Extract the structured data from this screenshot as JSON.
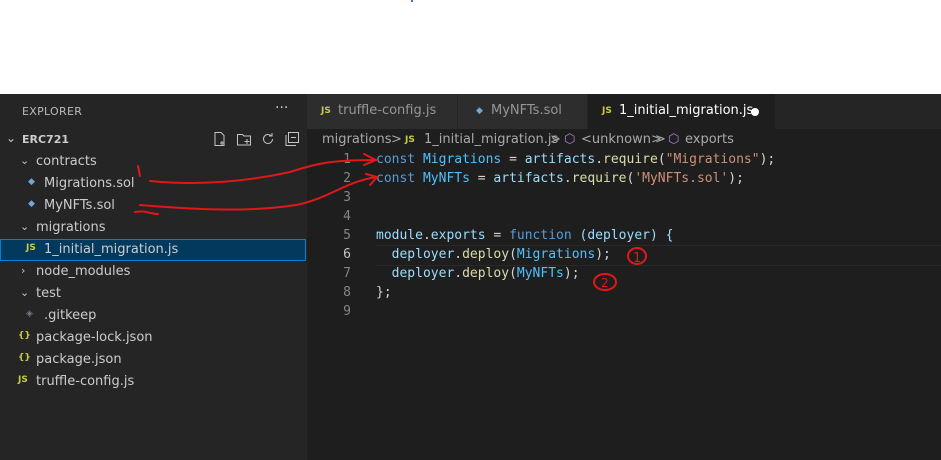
{
  "explorer": {
    "title": "EXPLORER",
    "more": "···",
    "section_title": "ERC721",
    "tree": [
      {
        "label": "contracts",
        "type": "folder",
        "expanded": true
      },
      {
        "label": "Migrations.sol",
        "type": "sol"
      },
      {
        "label": "MyNFTs.sol",
        "type": "sol"
      },
      {
        "label": "migrations",
        "type": "folder",
        "expanded": true
      },
      {
        "label": "1_initial_migration.js",
        "type": "js",
        "selected": true
      },
      {
        "label": "node_modules",
        "type": "folder",
        "expanded": false
      },
      {
        "label": "test",
        "type": "folder",
        "expanded": true
      },
      {
        "label": ".gitkeep",
        "type": "git"
      },
      {
        "label": "package-lock.json",
        "type": "json"
      },
      {
        "label": "package.json",
        "type": "json"
      },
      {
        "label": "truffle-config.js",
        "type": "js"
      }
    ]
  },
  "tabs": [
    {
      "label": "truffle-config.js",
      "icon": "JS",
      "active": false
    },
    {
      "label": "MyNFTs.sol",
      "icon": "sol",
      "active": false
    },
    {
      "label": "1_initial_migration.js",
      "icon": "JS",
      "active": true,
      "dirty": true
    }
  ],
  "breadcrumb": {
    "folder": "migrations",
    "file": "1_initial_migration.js",
    "symbol1": "<unknown>",
    "symbol2": "exports",
    "sep": ">"
  },
  "editor": {
    "line_numbers": [
      "1",
      "2",
      "3",
      "4",
      "5",
      "6",
      "7",
      "8",
      "9"
    ],
    "active_line": 6,
    "l1": {
      "kw": "const",
      "var": "Migrations",
      "eq": " = ",
      "obj": "artifacts",
      "dot": ".",
      "fn": "require",
      "open": "(",
      "str": "\"Migrations\"",
      "close": ");"
    },
    "l2": {
      "kw": "const",
      "var": "MyNFTs",
      "eq": " = ",
      "obj": "artifacts",
      "dot": ".",
      "fn": "require",
      "open": "(",
      "str": "'MyNFTs.sol'",
      "close": ");"
    },
    "l5": {
      "mod": "module",
      "dot": ".",
      "exports": "exports",
      "eq": " = ",
      "kw": "function",
      "params": " (deployer) {"
    },
    "l6": {
      "obj": "deployer",
      "dot": ".",
      "fn": "deploy",
      "open": "(",
      "arg": "Migrations",
      "close": ");"
    },
    "l7": {
      "obj": "deployer",
      "dot": ".",
      "fn": "deploy",
      "open": "(",
      "arg": "MyNFTs",
      "close": ");"
    },
    "l8": {
      "text": "};"
    }
  },
  "annotations": {
    "color": "#e01818",
    "num1": "1",
    "num2": "2",
    "circled1": "1",
    "circled2": "2"
  },
  "colors": {
    "sidebar_bg": "#252526",
    "editor_bg": "#1e1e1e",
    "selection": "#04395e",
    "keyword": "#569cd6",
    "string": "#ce9178",
    "function": "#dcdcaa"
  }
}
